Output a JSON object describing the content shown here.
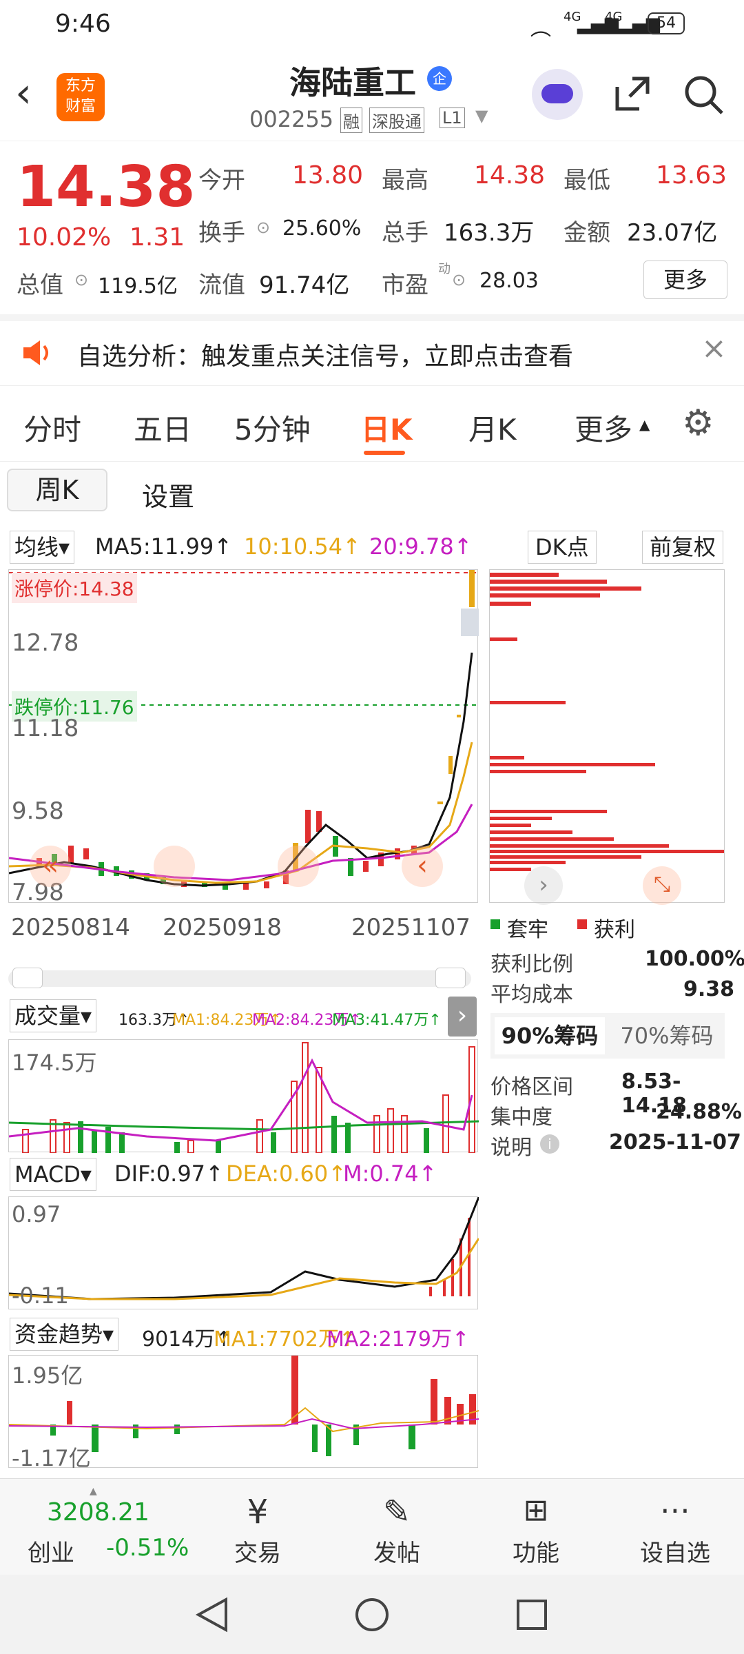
{
  "status": {
    "time": "9:46",
    "net1": "4G",
    "net2": "4G",
    "battery": "54"
  },
  "header": {
    "stock_name": "海陆重工",
    "badge": "企",
    "code": "002255",
    "tags": [
      "融",
      "深股通",
      "L1"
    ],
    "logo_line1": "东方",
    "logo_line2": "财富"
  },
  "quote": {
    "price": "14.38",
    "pct": "10.02%",
    "chg": "1.31",
    "open_l": "今开",
    "open_v": "13.80",
    "high_l": "最高",
    "high_v": "14.38",
    "low_l": "最低",
    "low_v": "13.63",
    "turn_l": "换手",
    "turn_v": "25.60%",
    "vol_l": "总手",
    "vol_v": "163.3万",
    "amt_l": "金额",
    "amt_v": "23.07亿",
    "mcap_l": "总值",
    "mcap_v": "119.5亿",
    "float_l": "流值",
    "float_v": "91.74亿",
    "pe_l": "市盈",
    "pe_sup": "动",
    "pe_v": "28.03",
    "more": "更多"
  },
  "alert": {
    "text": "自选分析：触发重点关注信号，立即点击查看"
  },
  "tabs": [
    "分时",
    "五日",
    "5分钟",
    "日K",
    "月K",
    "更多"
  ],
  "subtabs": {
    "week": "周K",
    "settings": "设置"
  },
  "ma": {
    "sel": "均线",
    "ma5": "MA5:11.99↑",
    "ma10": "10:10.54↑",
    "ma20": "20:9.78↑",
    "dk": "DK点",
    "fq": "前复权"
  },
  "kchart": {
    "limit_up": "涨停价:14.38",
    "limit_down": "跌停价:11.76",
    "y1": "12.78",
    "y2": "11.18",
    "y3": "9.58",
    "y4": "7.98",
    "dates": [
      "20250814",
      "20250918",
      "20251107"
    ]
  },
  "chip": {
    "legend_trap": "套牢",
    "legend_profit": "获利",
    "rows": [
      [
        "获利比例",
        "100.00%"
      ],
      [
        "平均成本",
        "9.38"
      ]
    ],
    "tab90": "90%筹码",
    "tab70": "70%筹码",
    "rows2": [
      [
        "价格区间",
        "8.53-14.18"
      ],
      [
        "集中度",
        "24.88%"
      ],
      [
        "说明",
        "2025-11-07"
      ]
    ]
  },
  "vol": {
    "sel": "成交量",
    "v": "163.3万↑",
    "ma1": "MA1:84.23万↑",
    "ma2": "MA2:84.23万↑",
    "ma3": "MA3:41.47万↑",
    "top": "174.5万"
  },
  "macd": {
    "sel": "MACD",
    "dif": "DIF:0.97↑",
    "dea": "DEA:0.60↑",
    "m": "M:0.74↑",
    "top": "0.97",
    "bot": "-0.11"
  },
  "fund": {
    "sel": "资金趋势",
    "v": "9014万↑",
    "ma1": "MA1:7702万↑",
    "ma2": "MA2:2179万↑",
    "top": "1.95亿",
    "bot": "-1.17亿"
  },
  "nav": {
    "index": "3208.21",
    "index_name": "创业",
    "index_pct": "-0.51%",
    "items": [
      "交易",
      "发帖",
      "功能",
      "设自选"
    ]
  },
  "colors": {
    "up": "#e02f2f",
    "down": "#18a02c",
    "accent": "#ff6a00"
  }
}
